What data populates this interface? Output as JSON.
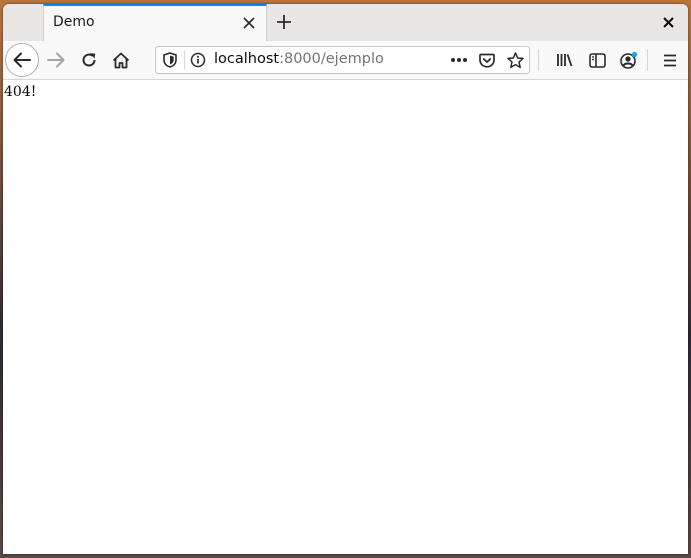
{
  "tab": {
    "title": "Demo"
  },
  "urlbar": {
    "host": "localhost",
    "rest": ":8000/ejemplo"
  },
  "page": {
    "body_text": "404!"
  },
  "icons": {
    "tab_close": "close-icon",
    "new_tab": "plus-icon",
    "window_close": "close-icon",
    "back": "arrow-left-icon",
    "forward": "arrow-right-icon",
    "reload": "reload-icon",
    "home": "home-icon",
    "tracking_protection": "shield-icon",
    "site_info": "info-icon",
    "page_actions": "more-horizontal-icon",
    "pocket": "pocket-icon",
    "bookmark": "star-icon",
    "library": "library-icon",
    "sidebar": "sidebar-icon",
    "account": "account-icon",
    "menu": "hamburger-menu-icon"
  },
  "colors": {
    "tab_accent": "#0a84ff",
    "account_badge": "#00b3f4"
  }
}
